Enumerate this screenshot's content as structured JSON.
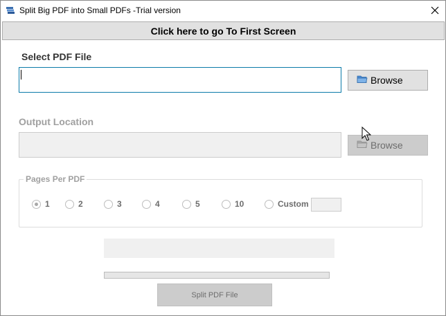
{
  "window": {
    "title": "Split  Big PDF into Small PDFs -Trial version",
    "app_icon": "pdf-stack-icon",
    "close_icon": "close-icon"
  },
  "header": {
    "first_screen_label": "Click here to go To First Screen"
  },
  "select_file": {
    "label": "Select PDF File",
    "value": "",
    "browse_label": "Browse"
  },
  "output": {
    "label": "Output Location",
    "value": "",
    "browse_label": "Browse"
  },
  "pages_per_pdf": {
    "legend": "Pages Per PDF",
    "options": [
      {
        "label": "1",
        "checked": true
      },
      {
        "label": "2",
        "checked": false
      },
      {
        "label": "3",
        "checked": false
      },
      {
        "label": "4",
        "checked": false
      },
      {
        "label": "5",
        "checked": false
      },
      {
        "label": "10",
        "checked": false
      },
      {
        "label": "Custom",
        "checked": false
      }
    ],
    "custom_value": ""
  },
  "progress": {
    "fraction": 0
  },
  "actions": {
    "split_label": "Split PDF File"
  },
  "colors": {
    "accent_border": "#0a7aa8",
    "button_bg": "#e1e1e1",
    "disabled_bg": "#cccccc",
    "disabled_text": "#6d6d6d"
  }
}
